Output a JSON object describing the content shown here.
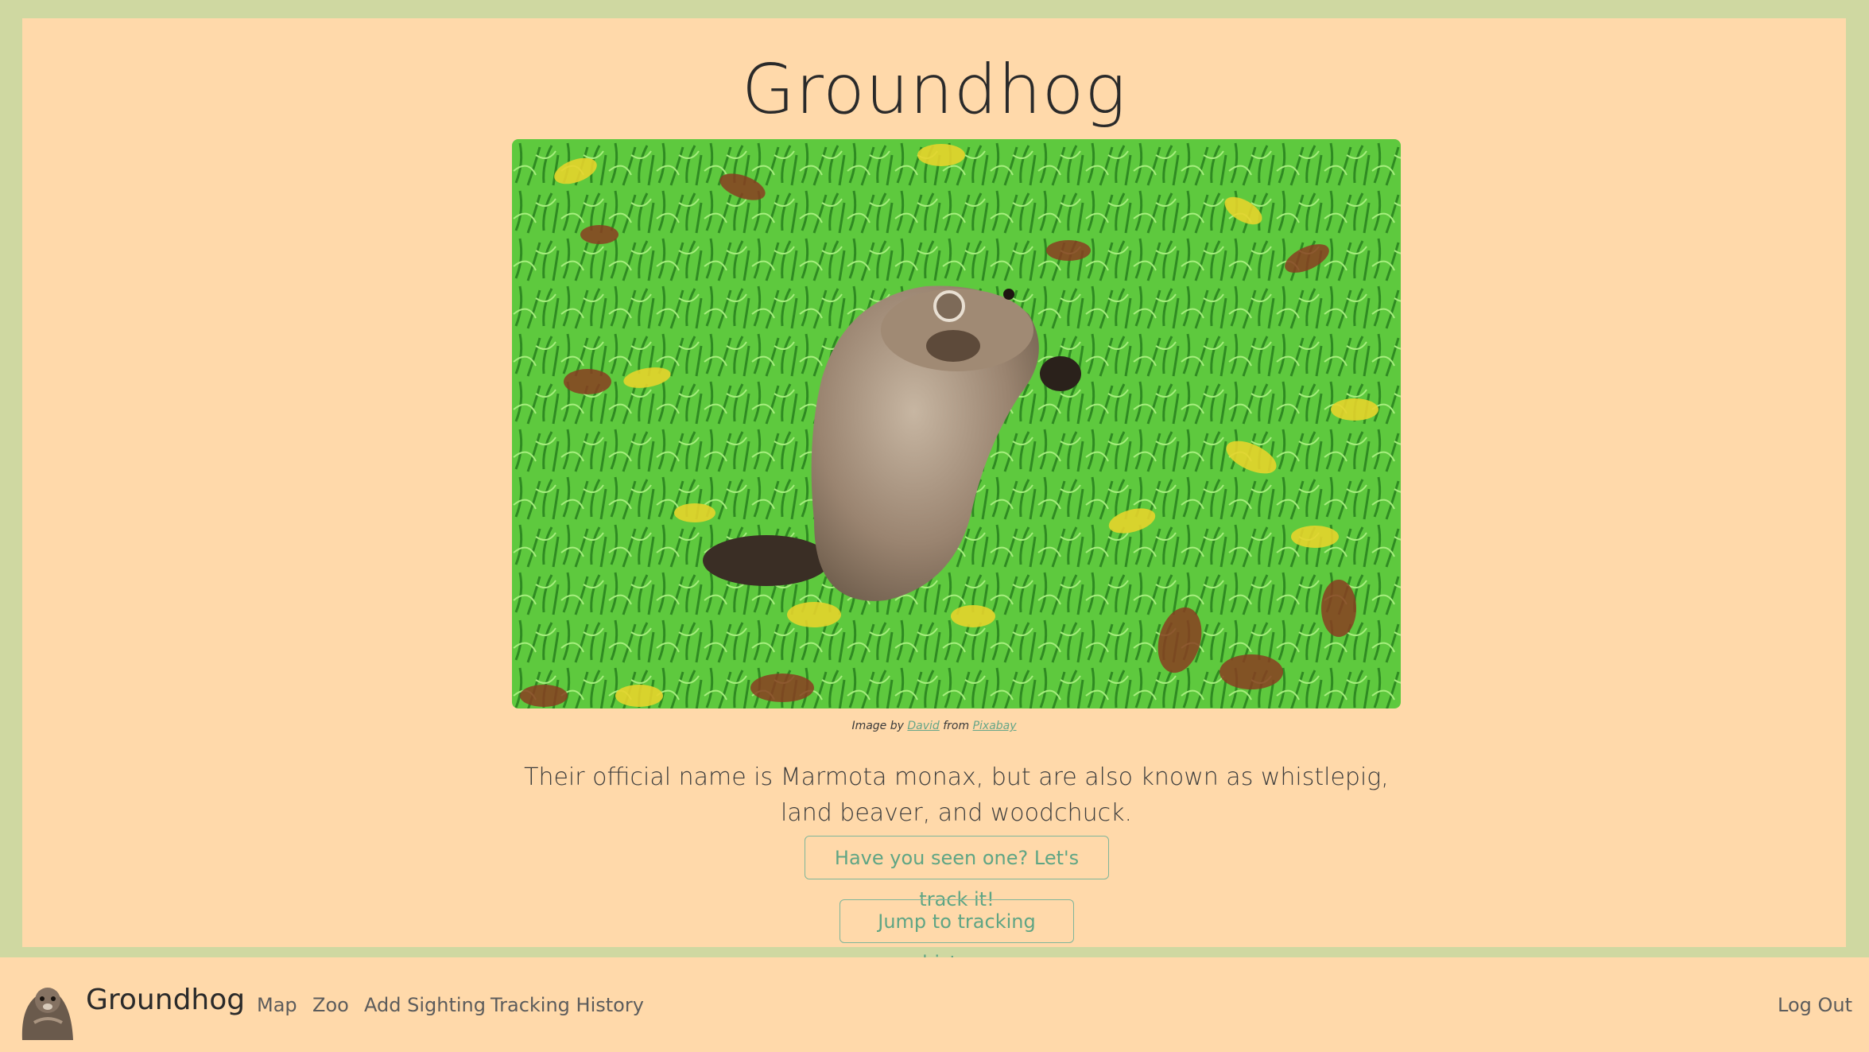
{
  "page": {
    "title": "Groundhog",
    "image_credit": {
      "prefix": "Image by",
      "author": "David",
      "middle": "from",
      "source": "Pixabay"
    },
    "description": "Their official name is Marmota monax, but are also known as whistlepig, land beaver, and woodchuck.",
    "track_button": "Have you seen one? Let's track it!",
    "history_button": "Jump to tracking history."
  },
  "navbar": {
    "brand": "Groundhog",
    "links": [
      "Map",
      "Zoo",
      "Add Sighting",
      "Tracking History"
    ],
    "logout": "Log Out"
  },
  "colors": {
    "outer": "#cfd8a1",
    "card": "#ffd9aa",
    "accent": "#5fa584"
  }
}
